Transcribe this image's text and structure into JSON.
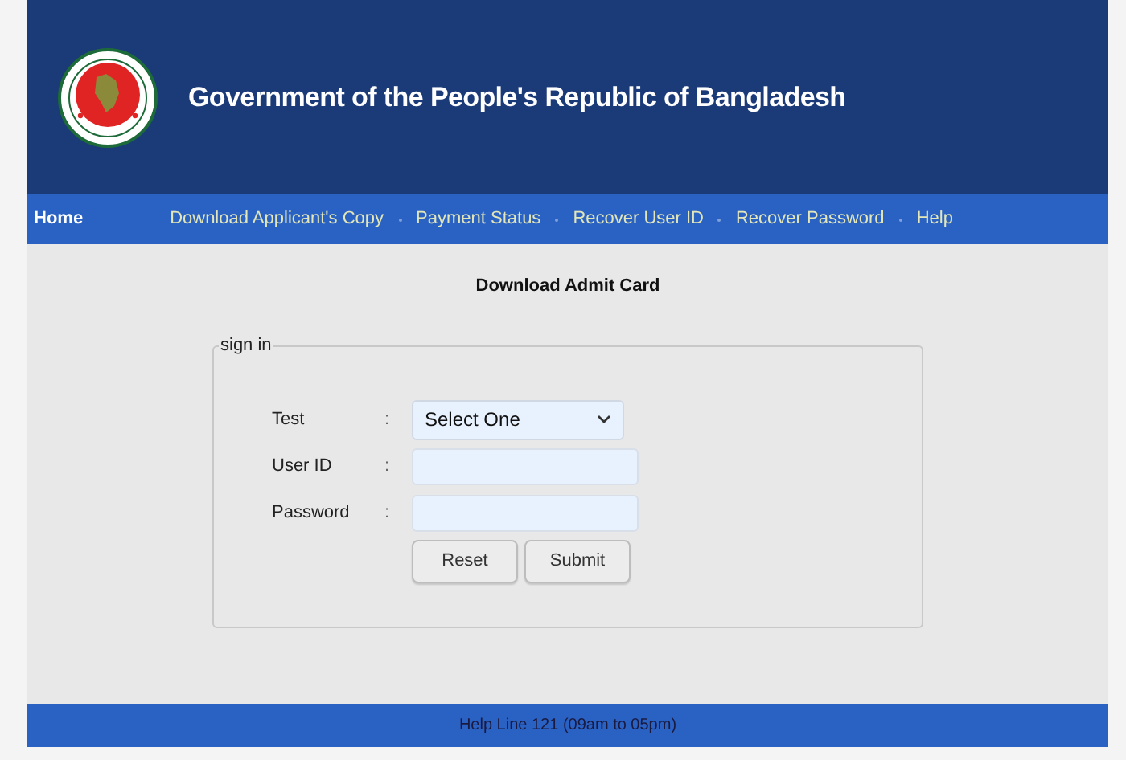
{
  "header": {
    "title": "Government of the People's Republic of Bangladesh"
  },
  "nav": [
    {
      "label": "Home",
      "selected": true
    },
    {
      "label": "Download Applicant's Copy",
      "selected": false
    },
    {
      "label": "Payment Status",
      "selected": false
    },
    {
      "label": "Recover User ID",
      "selected": false
    },
    {
      "label": "Recover Password",
      "selected": false
    },
    {
      "label": "Help",
      "selected": false
    }
  ],
  "page_title": "Download Admit Card",
  "form": {
    "legend": "sign in",
    "fields": [
      {
        "kind": "select",
        "label": "Test",
        "colon": ":",
        "value": "Select One"
      },
      {
        "kind": "text",
        "label": "User ID",
        "colon": ":"
      },
      {
        "kind": "password",
        "label": "Password",
        "colon": ":"
      }
    ],
    "buttons": [
      "Reset",
      "Submit"
    ]
  },
  "footer": "Help Line 121 (09am to 05pm)"
}
